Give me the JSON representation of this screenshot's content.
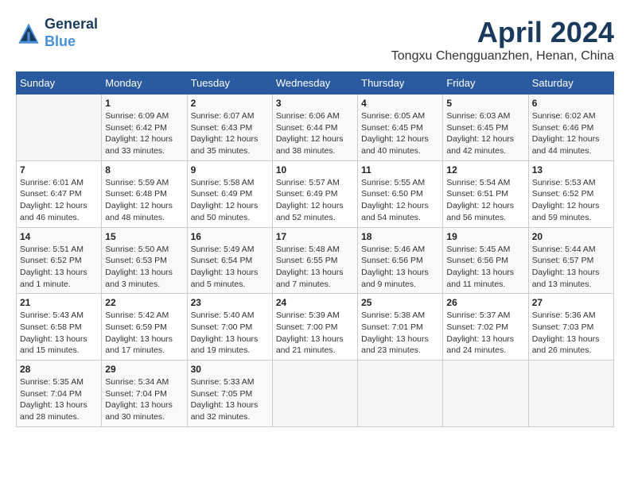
{
  "header": {
    "logo_line1": "General",
    "logo_line2": "Blue",
    "month": "April 2024",
    "location": "Tongxu Chengguanzhen, Henan, China"
  },
  "weekdays": [
    "Sunday",
    "Monday",
    "Tuesday",
    "Wednesday",
    "Thursday",
    "Friday",
    "Saturday"
  ],
  "weeks": [
    [
      {
        "day": "",
        "info": ""
      },
      {
        "day": "1",
        "info": "Sunrise: 6:09 AM\nSunset: 6:42 PM\nDaylight: 12 hours\nand 33 minutes."
      },
      {
        "day": "2",
        "info": "Sunrise: 6:07 AM\nSunset: 6:43 PM\nDaylight: 12 hours\nand 35 minutes."
      },
      {
        "day": "3",
        "info": "Sunrise: 6:06 AM\nSunset: 6:44 PM\nDaylight: 12 hours\nand 38 minutes."
      },
      {
        "day": "4",
        "info": "Sunrise: 6:05 AM\nSunset: 6:45 PM\nDaylight: 12 hours\nand 40 minutes."
      },
      {
        "day": "5",
        "info": "Sunrise: 6:03 AM\nSunset: 6:45 PM\nDaylight: 12 hours\nand 42 minutes."
      },
      {
        "day": "6",
        "info": "Sunrise: 6:02 AM\nSunset: 6:46 PM\nDaylight: 12 hours\nand 44 minutes."
      }
    ],
    [
      {
        "day": "7",
        "info": "Sunrise: 6:01 AM\nSunset: 6:47 PM\nDaylight: 12 hours\nand 46 minutes."
      },
      {
        "day": "8",
        "info": "Sunrise: 5:59 AM\nSunset: 6:48 PM\nDaylight: 12 hours\nand 48 minutes."
      },
      {
        "day": "9",
        "info": "Sunrise: 5:58 AM\nSunset: 6:49 PM\nDaylight: 12 hours\nand 50 minutes."
      },
      {
        "day": "10",
        "info": "Sunrise: 5:57 AM\nSunset: 6:49 PM\nDaylight: 12 hours\nand 52 minutes."
      },
      {
        "day": "11",
        "info": "Sunrise: 5:55 AM\nSunset: 6:50 PM\nDaylight: 12 hours\nand 54 minutes."
      },
      {
        "day": "12",
        "info": "Sunrise: 5:54 AM\nSunset: 6:51 PM\nDaylight: 12 hours\nand 56 minutes."
      },
      {
        "day": "13",
        "info": "Sunrise: 5:53 AM\nSunset: 6:52 PM\nDaylight: 12 hours\nand 59 minutes."
      }
    ],
    [
      {
        "day": "14",
        "info": "Sunrise: 5:51 AM\nSunset: 6:52 PM\nDaylight: 13 hours\nand 1 minute."
      },
      {
        "day": "15",
        "info": "Sunrise: 5:50 AM\nSunset: 6:53 PM\nDaylight: 13 hours\nand 3 minutes."
      },
      {
        "day": "16",
        "info": "Sunrise: 5:49 AM\nSunset: 6:54 PM\nDaylight: 13 hours\nand 5 minutes."
      },
      {
        "day": "17",
        "info": "Sunrise: 5:48 AM\nSunset: 6:55 PM\nDaylight: 13 hours\nand 7 minutes."
      },
      {
        "day": "18",
        "info": "Sunrise: 5:46 AM\nSunset: 6:56 PM\nDaylight: 13 hours\nand 9 minutes."
      },
      {
        "day": "19",
        "info": "Sunrise: 5:45 AM\nSunset: 6:56 PM\nDaylight: 13 hours\nand 11 minutes."
      },
      {
        "day": "20",
        "info": "Sunrise: 5:44 AM\nSunset: 6:57 PM\nDaylight: 13 hours\nand 13 minutes."
      }
    ],
    [
      {
        "day": "21",
        "info": "Sunrise: 5:43 AM\nSunset: 6:58 PM\nDaylight: 13 hours\nand 15 minutes."
      },
      {
        "day": "22",
        "info": "Sunrise: 5:42 AM\nSunset: 6:59 PM\nDaylight: 13 hours\nand 17 minutes."
      },
      {
        "day": "23",
        "info": "Sunrise: 5:40 AM\nSunset: 7:00 PM\nDaylight: 13 hours\nand 19 minutes."
      },
      {
        "day": "24",
        "info": "Sunrise: 5:39 AM\nSunset: 7:00 PM\nDaylight: 13 hours\nand 21 minutes."
      },
      {
        "day": "25",
        "info": "Sunrise: 5:38 AM\nSunset: 7:01 PM\nDaylight: 13 hours\nand 23 minutes."
      },
      {
        "day": "26",
        "info": "Sunrise: 5:37 AM\nSunset: 7:02 PM\nDaylight: 13 hours\nand 24 minutes."
      },
      {
        "day": "27",
        "info": "Sunrise: 5:36 AM\nSunset: 7:03 PM\nDaylight: 13 hours\nand 26 minutes."
      }
    ],
    [
      {
        "day": "28",
        "info": "Sunrise: 5:35 AM\nSunset: 7:04 PM\nDaylight: 13 hours\nand 28 minutes."
      },
      {
        "day": "29",
        "info": "Sunrise: 5:34 AM\nSunset: 7:04 PM\nDaylight: 13 hours\nand 30 minutes."
      },
      {
        "day": "30",
        "info": "Sunrise: 5:33 AM\nSunset: 7:05 PM\nDaylight: 13 hours\nand 32 minutes."
      },
      {
        "day": "",
        "info": ""
      },
      {
        "day": "",
        "info": ""
      },
      {
        "day": "",
        "info": ""
      },
      {
        "day": "",
        "info": ""
      }
    ]
  ]
}
